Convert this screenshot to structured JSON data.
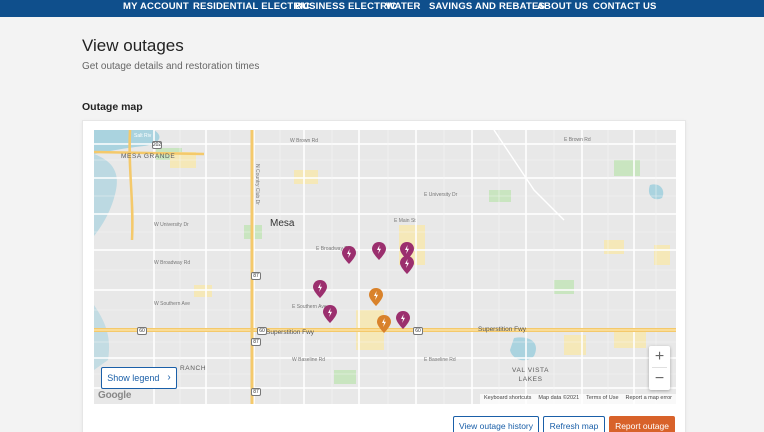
{
  "nav": {
    "items": [
      {
        "label": "MY ACCOUNT"
      },
      {
        "label": "RESIDENTIAL ELECTRIC"
      },
      {
        "label": "BUSINESS ELECTRIC"
      },
      {
        "label": "WATER"
      },
      {
        "label": "SAVINGS AND REBATES"
      },
      {
        "label": "ABOUT US"
      },
      {
        "label": "CONTACT US"
      }
    ]
  },
  "page": {
    "title": "View outages",
    "subtitle": "Get outage details and restoration times",
    "section_title": "Outage map"
  },
  "map": {
    "area_labels": {
      "mesa_grande": "MESA GRANDE",
      "mesa": "Mesa",
      "ranch": "RANCH",
      "val_vista_lakes": "VAL VISTA\nLAKES",
      "salt_river": "Salt Riv"
    },
    "road_labels": {
      "brown_w": "W Brown Rd",
      "brown_e": "E Brown Rd",
      "university_w": "W University Dr",
      "university_e": "E University Dr",
      "main_e": "E Main St",
      "broadway_w": "W Broadway Rd",
      "broadway_e": "E Broadway Rd",
      "southern_w": "W Southern Ave",
      "southern_e": "E Southern Ave",
      "baseline_w": "W Baseline Rd",
      "baseline_e": "E Baseline Rd",
      "country_club": "N Country Club Dr",
      "freeway_w": "Superstition Fwy",
      "freeway_e": "Superstition Fwy"
    },
    "shields": [
      "202",
      "87",
      "87",
      "60",
      "60",
      "60",
      "87"
    ],
    "outage_pins": [
      {
        "status": "purple"
      },
      {
        "status": "purple"
      },
      {
        "status": "purple"
      },
      {
        "status": "purple"
      },
      {
        "status": "purple"
      },
      {
        "status": "purple"
      },
      {
        "status": "orange"
      },
      {
        "status": "orange"
      },
      {
        "status": "purple"
      }
    ],
    "show_legend_label": "Show legend",
    "zoom_in": "+",
    "zoom_out": "−",
    "google": "Google",
    "attribution": {
      "keyboard": "Keyboard shortcuts",
      "data": "Map data ©2021",
      "terms": "Terms of Use",
      "report": "Report a map error"
    }
  },
  "actions": {
    "history": "View outage history",
    "refresh": "Refresh map",
    "report": "Report outage"
  },
  "colors": {
    "nav_bg": "#0f4f8c",
    "primary": "#1a5fa8",
    "accent": "#d8622a",
    "pin_purple": "#9b2f6e",
    "pin_orange": "#d9822b"
  }
}
